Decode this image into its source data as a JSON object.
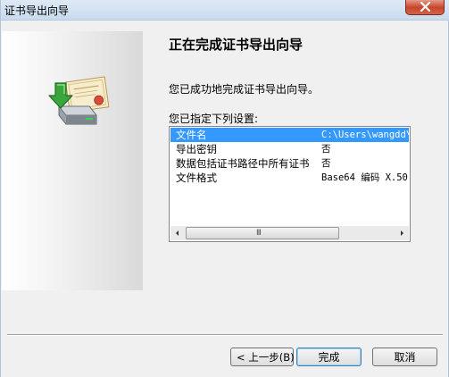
{
  "window": {
    "title": "证书导出向导"
  },
  "page": {
    "heading": "正在完成证书导出向导",
    "success_text": "您已成功地完成证书导出向导。",
    "settings_label": "您已指定下列设置:"
  },
  "settings": {
    "rows": [
      {
        "name": "文件名",
        "value": "C:\\Users\\wangdd\\"
      },
      {
        "name": "导出密钥",
        "value": "否"
      },
      {
        "name": "数据包括证书路径中所有证书",
        "value": "否"
      },
      {
        "name": "文件格式",
        "value": "Base64 编码 X.50"
      }
    ],
    "selected_index": 0,
    "scroll_grip": "III"
  },
  "buttons": {
    "back": "< 上一步(B)",
    "finish": "完成",
    "cancel": "取消"
  },
  "icons": {
    "wizard_art": "certificate-export-icon",
    "close": "close-icon",
    "scroll_left": "scroll-left-arrow-icon",
    "scroll_right": "scroll-right-arrow-icon"
  },
  "colors": {
    "selection": "#3399ff",
    "close_button": "#c7452c"
  }
}
